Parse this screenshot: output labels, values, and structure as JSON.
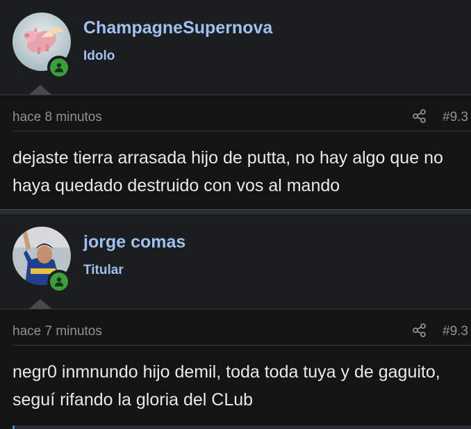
{
  "posts": [
    {
      "username": "ChampagneSupernova",
      "user_title": "Idolo",
      "avatar": "flying-pig-avatar",
      "time": "hace 8 minutos",
      "post_number": "#9.3",
      "message": "dejaste tierra arrasada hijo de putta, no hay algo que no haya quedado destruido con vos al mando"
    },
    {
      "username": "jorge comas",
      "user_title": "Titular",
      "avatar": "football-player-avatar",
      "time": "hace 7 minutos",
      "post_number": "#9.3",
      "message": "negr0 inmnundo hijo demil, toda toda tuya y de gaguito, seguí rifando la gloria del CLub"
    }
  ],
  "colors": {
    "background": "#141414",
    "username": "#9fc1f2",
    "meta_text": "#8f9297",
    "message_text": "#e9e9ea",
    "online": "#3f9c3f"
  },
  "icons": {
    "share": "share-icon",
    "online": "online-status-icon"
  }
}
